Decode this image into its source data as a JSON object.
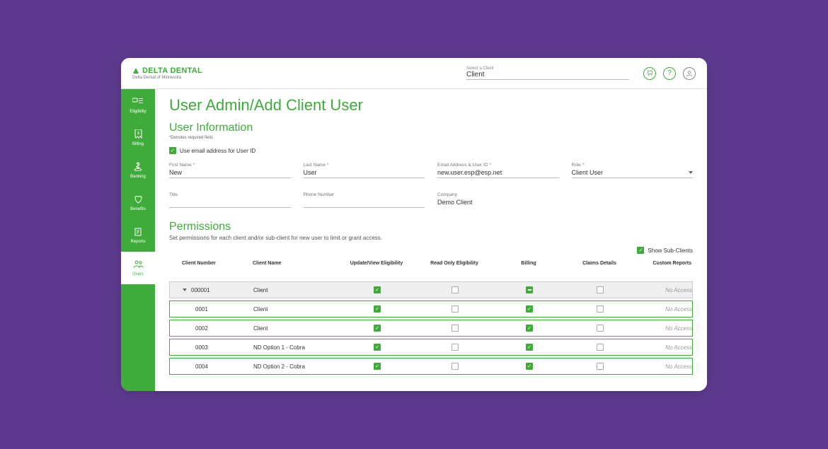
{
  "header": {
    "brand": "DELTA DENTAL",
    "brand_sub": "Delta Dental of Minnesota",
    "client_select_label": "Select a Client",
    "client_select_value": "Client"
  },
  "sidebar": {
    "items": [
      {
        "label": "Eligibility"
      },
      {
        "label": "Billing"
      },
      {
        "label": "Banking"
      },
      {
        "label": "Benefits"
      },
      {
        "label": "Reports"
      },
      {
        "label": "Users"
      }
    ]
  },
  "page": {
    "title": "User Admin/Add Client User",
    "section1_title": "User Information",
    "required_note": "*Denotes required field.",
    "use_email_label": "Use email address for User ID",
    "fields": {
      "first_name_label": "First Name",
      "first_name_value": "New",
      "last_name_label": "Last Name",
      "last_name_value": "User",
      "email_label": "Email Address & User ID",
      "email_value": "new.user.esp@esp.net",
      "role_label": "Role",
      "role_value": "Client User",
      "title_label": "Title",
      "title_value": "",
      "phone_label": "Phone Number",
      "phone_value": "",
      "company_label": "Company",
      "company_value": "Demo Client"
    },
    "section2_title": "Permissions",
    "permissions_desc": "Set permissions for each client and/or sub-client for new user to limit or grant access.",
    "show_sub_label": "Show Sub-Clients",
    "columns": {
      "c1": "Client Number",
      "c2": "Client Name",
      "c3": "Update/View Eligibility",
      "c4": "Read Only Eligibility",
      "c5": "Billing",
      "c6": "Claims Details",
      "c7": "Custom Reports"
    },
    "rows": [
      {
        "num": "000001",
        "name": "Client",
        "update": true,
        "read": false,
        "billing": "mixed",
        "claims": false,
        "reports": "No Access",
        "parent": true
      },
      {
        "num": "0001",
        "name": "Client",
        "update": true,
        "read": false,
        "billing": true,
        "claims": false,
        "reports": "No Access",
        "parent": false
      },
      {
        "num": "0002",
        "name": "Client",
        "update": true,
        "read": false,
        "billing": true,
        "claims": false,
        "reports": "No Access",
        "parent": false
      },
      {
        "num": "0003",
        "name": "ND Option 1 - Cobra",
        "update": true,
        "read": false,
        "billing": true,
        "claims": false,
        "reports": "No Access",
        "parent": false
      },
      {
        "num": "0004",
        "name": "ND Option 2 - Cobra",
        "update": true,
        "read": false,
        "billing": true,
        "claims": false,
        "reports": "No Access",
        "parent": false
      }
    ]
  }
}
